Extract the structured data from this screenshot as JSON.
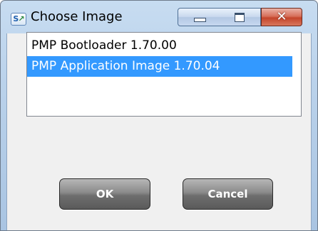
{
  "window": {
    "title": "Choose Image",
    "app_icon_label": "S",
    "app_icon_glyph": "↗"
  },
  "titlebar_buttons": {
    "close_glyph": "✕"
  },
  "list": {
    "items": [
      {
        "label": "PMP Bootloader 1.70.00",
        "selected": false
      },
      {
        "label": "PMP Application Image 1.70.04",
        "selected": true
      }
    ]
  },
  "buttons": {
    "ok_label": "OK",
    "cancel_label": "Cancel"
  },
  "colors": {
    "selection": "#3399ff",
    "titlebar": "#b9d1ea",
    "close_button": "#c4452b",
    "button_face": "#6e6e6e"
  },
  "icons": {
    "app": "app-icon",
    "minimize": "minimize-icon",
    "maximize": "maximize-icon",
    "close": "close-icon"
  }
}
